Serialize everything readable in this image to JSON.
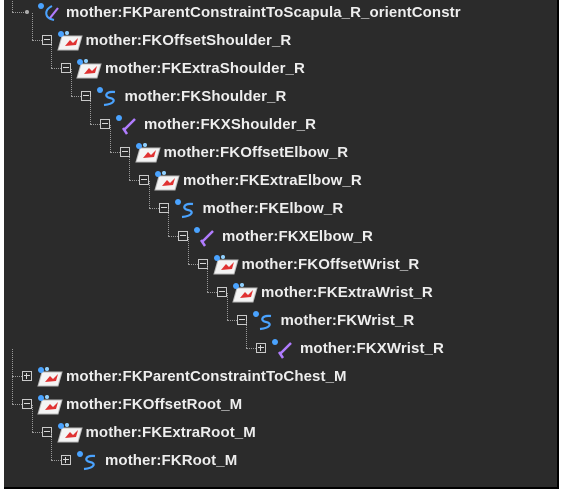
{
  "outliner": {
    "rows": [
      {
        "label": "mother:FKParentConstraintToScapula_R_orientConstr",
        "icon": "orient-constraint-icon",
        "expander": "none",
        "depth": 0
      },
      {
        "label": "mother:FKOffsetShoulder_R",
        "icon": "transform-node-icon",
        "expander": "expanded",
        "depth": 1
      },
      {
        "label": "mother:FKExtraShoulder_R",
        "icon": "transform-node-icon",
        "expander": "expanded",
        "depth": 2
      },
      {
        "label": "mother:FKShoulder_R",
        "icon": "joint-curve-icon",
        "expander": "expanded",
        "depth": 3
      },
      {
        "label": "mother:FKXShoulder_R",
        "icon": "joint-icon",
        "expander": "expanded",
        "depth": 4
      },
      {
        "label": "mother:FKOffsetElbow_R",
        "icon": "transform-node-icon",
        "expander": "expanded",
        "depth": 5
      },
      {
        "label": "mother:FKExtraElbow_R",
        "icon": "transform-node-icon",
        "expander": "expanded",
        "depth": 6
      },
      {
        "label": "mother:FKElbow_R",
        "icon": "joint-curve-icon",
        "expander": "expanded",
        "depth": 7
      },
      {
        "label": "mother:FKXElbow_R",
        "icon": "joint-icon",
        "expander": "expanded",
        "depth": 8
      },
      {
        "label": "mother:FKOffsetWrist_R",
        "icon": "transform-node-icon",
        "expander": "expanded",
        "depth": 9
      },
      {
        "label": "mother:FKExtraWrist_R",
        "icon": "transform-node-icon",
        "expander": "expanded",
        "depth": 10
      },
      {
        "label": "mother:FKWrist_R",
        "icon": "joint-curve-icon",
        "expander": "expanded",
        "depth": 11
      },
      {
        "label": "mother:FKXWrist_R",
        "icon": "joint-icon",
        "expander": "collapsed",
        "depth": 12
      },
      {
        "label": "mother:FKParentConstraintToChest_M",
        "icon": "transform-node-icon",
        "expander": "collapsed",
        "depth": 0
      },
      {
        "label": "mother:FKOffsetRoot_M",
        "icon": "transform-node-icon",
        "expander": "expanded",
        "depth": 0
      },
      {
        "label": "mother:FKExtraRoot_M",
        "icon": "transform-node-icon",
        "expander": "expanded",
        "depth": 1
      },
      {
        "label": "mother:FKRoot_M",
        "icon": "joint-curve-icon",
        "expander": "collapsed",
        "depth": 2
      }
    ]
  },
  "colors": {
    "background": "#2b2b2b",
    "text": "#eeeeee",
    "guide": "#9a9a9a",
    "transform_icon_red": "#e03232",
    "joint_blue": "#4aa3ff",
    "joint_purple": "#b07cff"
  }
}
